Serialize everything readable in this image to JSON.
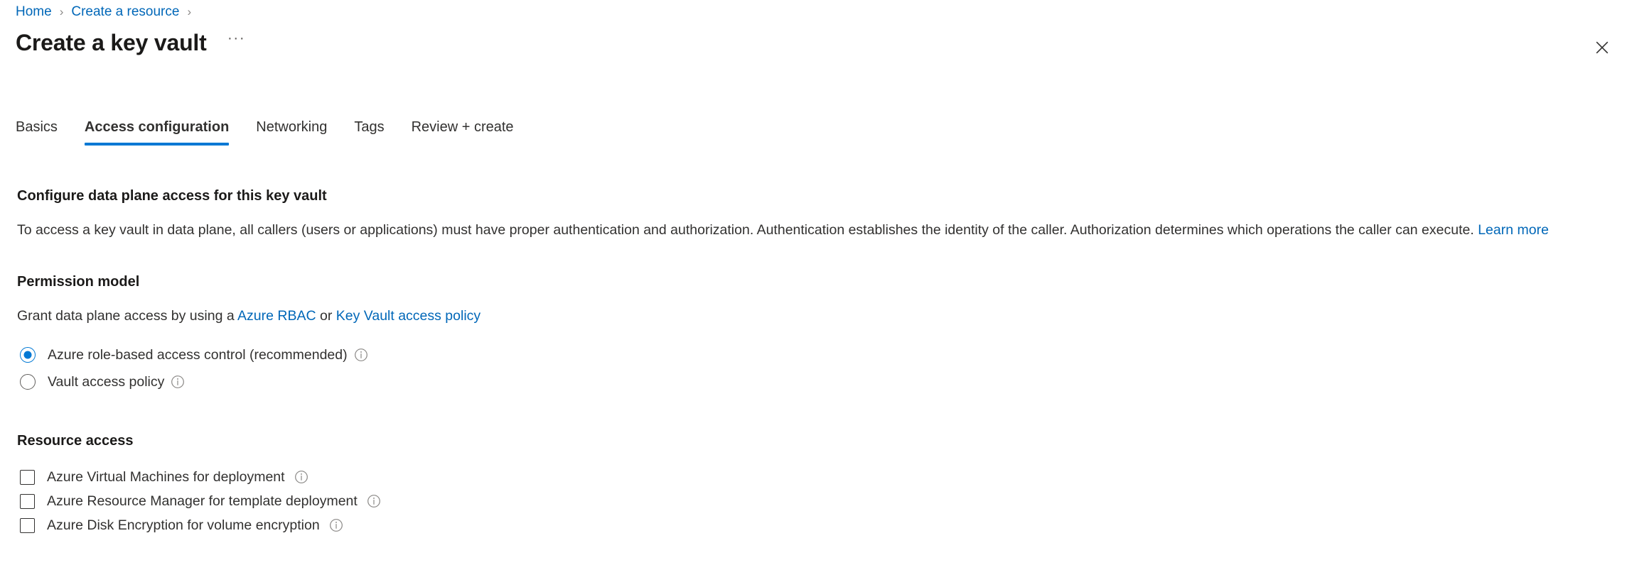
{
  "breadcrumb": {
    "items": [
      {
        "label": "Home"
      },
      {
        "label": "Create a resource"
      }
    ],
    "separator": "›"
  },
  "header": {
    "title": "Create a key vault",
    "more_menu_label": "···",
    "close_icon_name": "close-icon"
  },
  "tabs": [
    {
      "label": "Basics",
      "active": false
    },
    {
      "label": "Access configuration",
      "active": true
    },
    {
      "label": "Networking",
      "active": false
    },
    {
      "label": "Tags",
      "active": false
    },
    {
      "label": "Review + create",
      "active": false
    }
  ],
  "configure_section": {
    "heading": "Configure data plane access for this key vault",
    "description_text": "To access a key vault in data plane, all callers (users or applications) must have proper authentication and authorization. Authentication establishes the identity of the caller. Authorization determines which operations the caller can execute.",
    "learn_more_label": "Learn more"
  },
  "permission_model": {
    "heading": "Permission model",
    "grant_prefix": "Grant data plane access by using a",
    "link_rbac": "Azure RBAC",
    "grant_conjunction": "or",
    "link_access_policy": "Key Vault access policy",
    "options": [
      {
        "label": "Azure role-based access control (recommended)",
        "selected": true
      },
      {
        "label": "Vault access policy",
        "selected": false
      }
    ]
  },
  "resource_access": {
    "heading": "Resource access",
    "options": [
      {
        "label": "Azure Virtual Machines for deployment",
        "checked": false
      },
      {
        "label": "Azure Resource Manager for template deployment",
        "checked": false
      },
      {
        "label": "Azure Disk Encryption for volume encryption",
        "checked": false
      }
    ]
  },
  "colors": {
    "accent": "#0078d4",
    "link": "#0067b8",
    "text": "#323130",
    "heading": "#1b1a19",
    "muted": "#8a8886"
  }
}
